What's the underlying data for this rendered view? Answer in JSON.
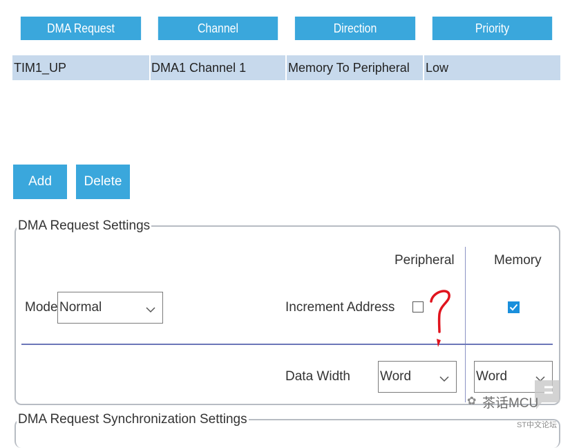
{
  "table": {
    "headers": [
      "DMA Request",
      "Channel",
      "Direction",
      "Priority"
    ],
    "rows": [
      {
        "request": "TIM1_UP",
        "channel": "DMA1 Channel 1",
        "direction": "Memory To Peripheral",
        "priority": "Low"
      }
    ]
  },
  "buttons": {
    "add": "Add",
    "delete": "Delete"
  },
  "settings": {
    "legend": "DMA Request Settings",
    "col_peripheral": "Peripheral",
    "col_memory": "Memory",
    "mode_label": "Mode",
    "mode_value": "Normal",
    "increment_label": "Increment Address",
    "increment_peripheral_checked": false,
    "increment_memory_checked": true,
    "data_width_label": "Data Width",
    "data_width_peripheral": "Word",
    "data_width_memory": "Word"
  },
  "sync_settings": {
    "legend": "DMA Request Synchronization Settings"
  },
  "annotation": {
    "mark": "?"
  },
  "watermark": {
    "main": "茶话MCU",
    "sub": "ST中文论坛"
  },
  "colors": {
    "header_bg": "#3aa7dc",
    "row_bg": "#c7d9ec",
    "check_blue": "#1a8fdc",
    "annotation_red": "#e0141e"
  }
}
